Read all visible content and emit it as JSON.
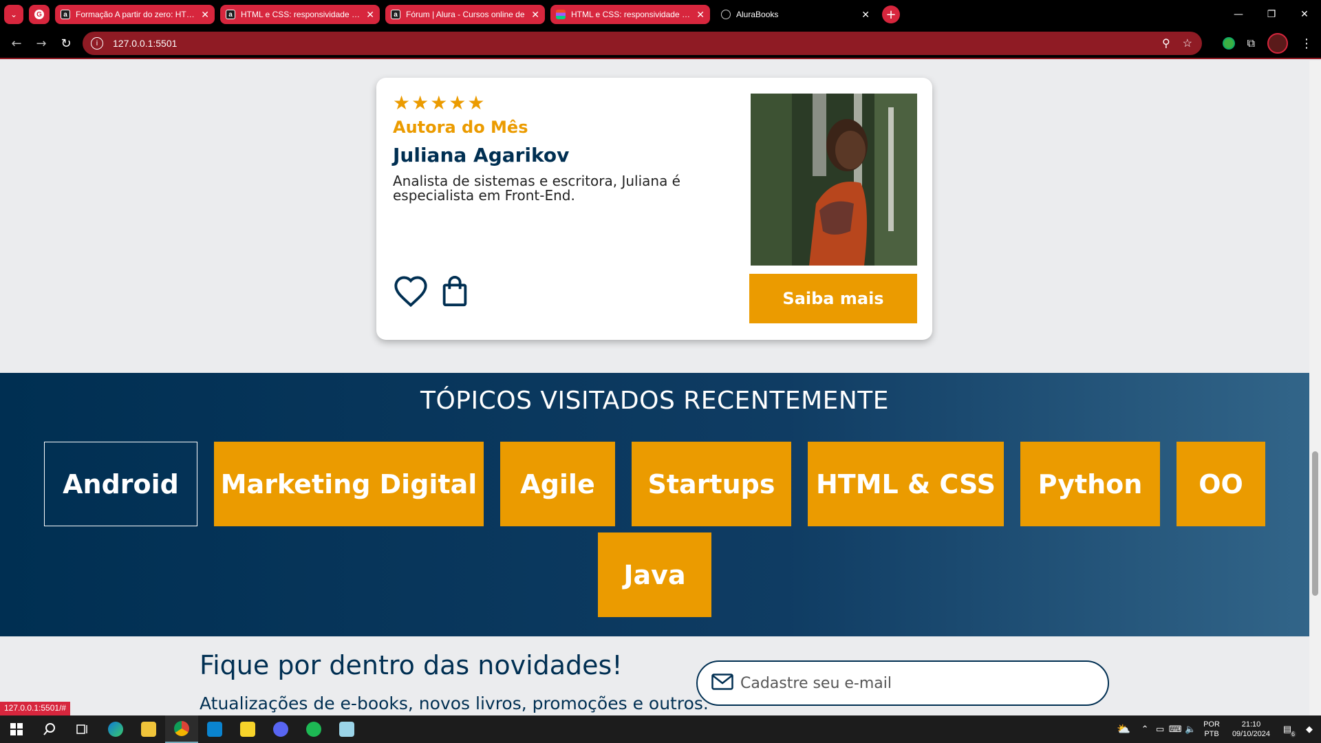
{
  "browser": {
    "tabs": [
      {
        "title": "Formação A partir do zero: HTML",
        "favicon": "alura-icon"
      },
      {
        "title": "HTML e CSS: responsividade com",
        "favicon": "alura-icon"
      },
      {
        "title": "Fórum | Alura - Cursos online de",
        "favicon": "alura-icon"
      },
      {
        "title": "HTML e CSS: responsividade com",
        "favicon": "figma-icon"
      },
      {
        "title": "AluraBooks",
        "favicon": "globe-icon"
      }
    ],
    "url": "127.0.0.1:5501",
    "status_url": "127.0.0.1:5501/#",
    "accent_color": "#d7263d"
  },
  "author_card": {
    "stars": "★★★★★",
    "label": "Autora do Mês",
    "name": "Juliana Agarikov",
    "description": "Analista de sistemas e escritora, Juliana é especialista em Front-End.",
    "button": "Saiba mais",
    "rating": 5
  },
  "topics": {
    "title": "TÓPICOS VISITADOS RECENTEMENTE",
    "items": [
      {
        "label": "Android",
        "selected": true
      },
      {
        "label": "Marketing Digital",
        "selected": false
      },
      {
        "label": "Agile",
        "selected": false
      },
      {
        "label": "Startups",
        "selected": false
      },
      {
        "label": "HTML & CSS",
        "selected": false
      },
      {
        "label": "Python",
        "selected": false
      },
      {
        "label": "OO",
        "selected": false
      },
      {
        "label": "Java",
        "selected": false
      }
    ]
  },
  "newsletter": {
    "title": "Fique por dentro das novidades!",
    "subtitle": "Atualizações de e-books, novos livros, promoções e outros.",
    "email_placeholder": "Cadastre seu e-mail"
  },
  "taskbar": {
    "lang_top": "POR",
    "lang_bottom": "PTB",
    "time": "21:10",
    "date": "09/10/2024",
    "notification_count": "6"
  },
  "colors": {
    "brand_orange": "#eb9b00",
    "brand_blue": "#002f52"
  }
}
